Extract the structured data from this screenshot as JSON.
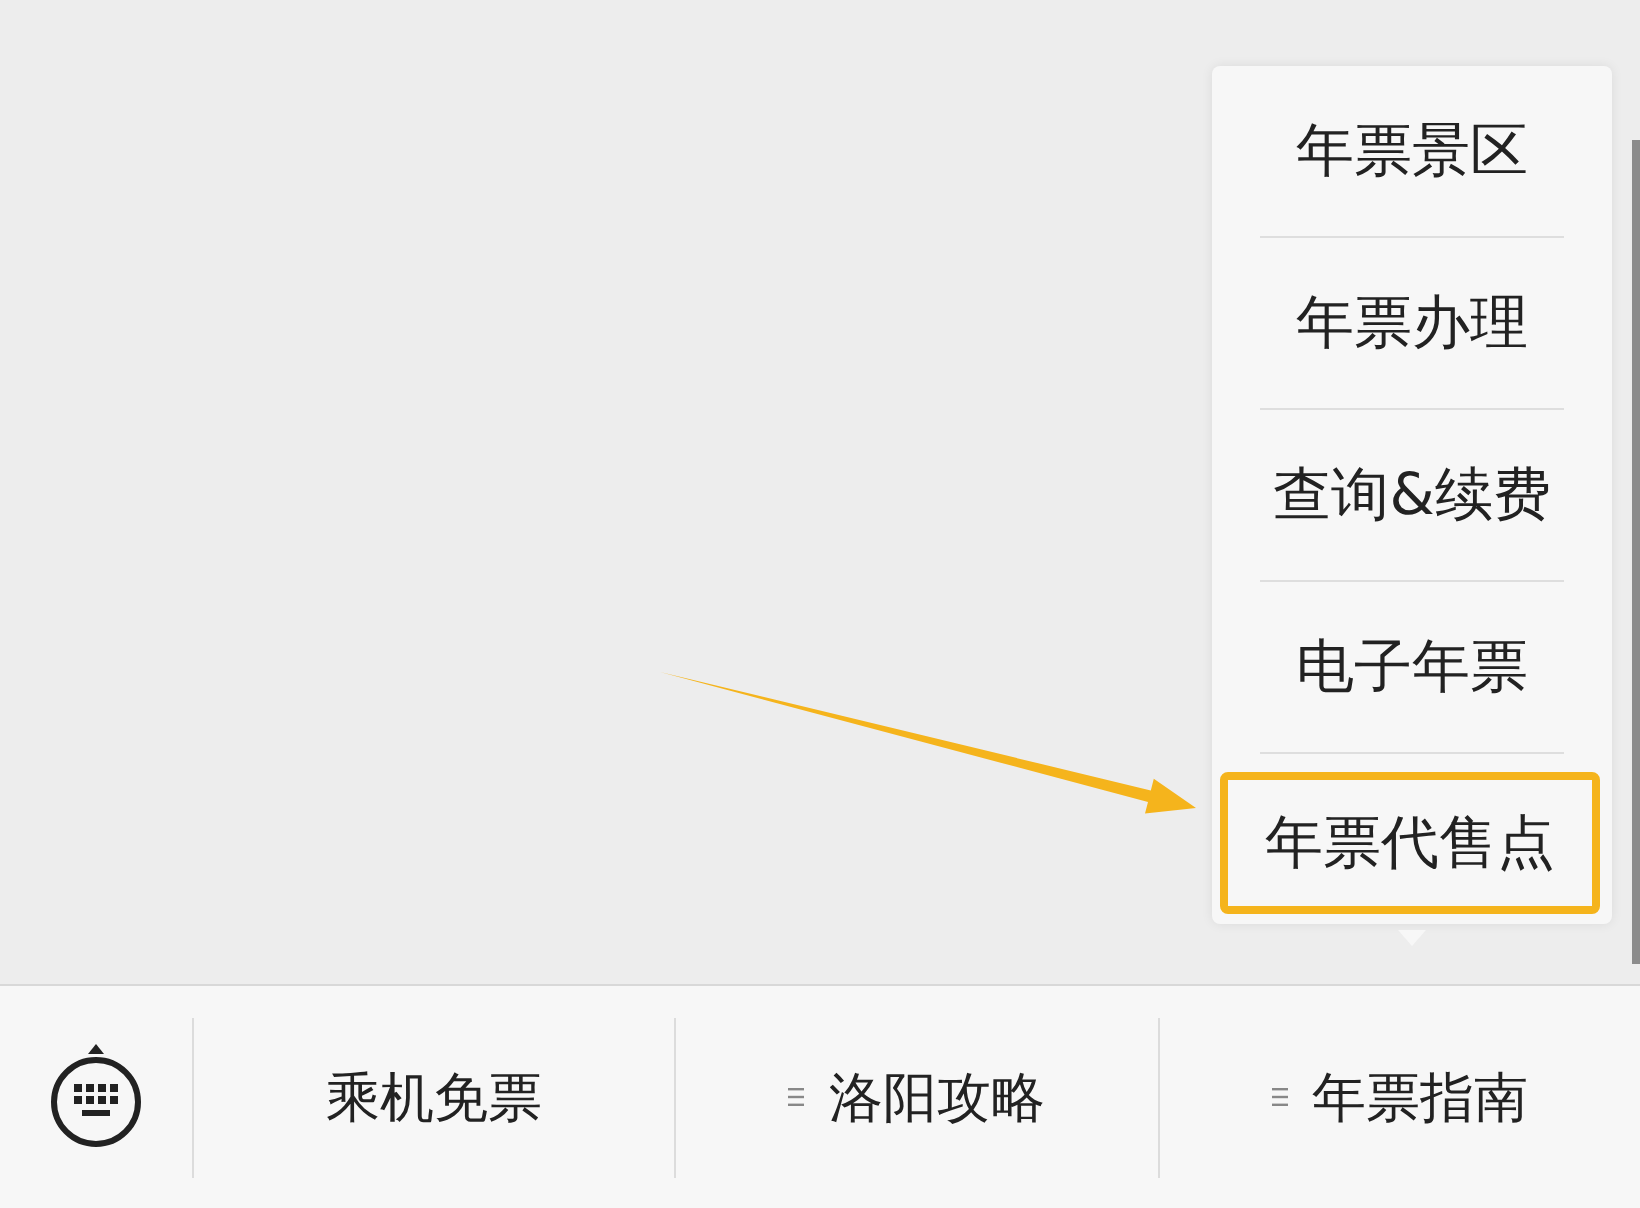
{
  "menu": {
    "items": [
      {
        "label": "年票景区",
        "highlighted": false
      },
      {
        "label": "年票办理",
        "highlighted": false
      },
      {
        "label": "查询&续费",
        "highlighted": false
      },
      {
        "label": "电子年票",
        "highlighted": false
      },
      {
        "label": "年票代售点",
        "highlighted": true
      }
    ]
  },
  "bottom_bar": {
    "tabs": [
      {
        "label": "乘机免票",
        "has_submenu": false
      },
      {
        "label": "洛阳攻略",
        "has_submenu": true
      },
      {
        "label": "年票指南",
        "has_submenu": true
      }
    ]
  }
}
